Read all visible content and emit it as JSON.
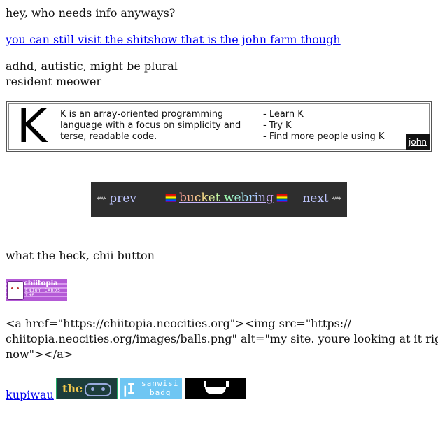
{
  "intro": {
    "line1": "hey, who needs info anyways?",
    "farm_link": "you can still visit the shitshow that is the john farm though",
    "bio1": "adhd, autistic, might be plural",
    "bio2": "resident meower"
  },
  "k_banner": {
    "letter": "K",
    "desc": "K is an array-oriented programming language with a focus on simplicity and terse, readable code.",
    "bullets": [
      "- Learn K",
      "- Try K",
      "- Find more people using K"
    ],
    "john_label": "john"
  },
  "webring": {
    "prev_arrow": "⇜",
    "prev": "prev",
    "name": "bucket webring",
    "next": "next",
    "next_arrow": "⇝"
  },
  "chii": {
    "heading": "what the heck, chii button",
    "button_title": "chiitopia",
    "button_sub1": "ENJOY CARDS",
    "button_sub2": "THE",
    "code": "<a href=\"https://chiitopia.neocities.org\"><img src=\"https://",
    "code2": "chiitopia.neocities.org/images/balls.png\" alt=\"my site. youre looking at it right",
    "code3": "now\"></a>"
  },
  "footer": {
    "kupiwau": "kupiwau",
    "btn_the": "the",
    "btn_sanwisi_glyph": "ꞁI",
    "btn_sanwisi_1": "sanwisi",
    "btn_sanwisi_2": "badg"
  }
}
